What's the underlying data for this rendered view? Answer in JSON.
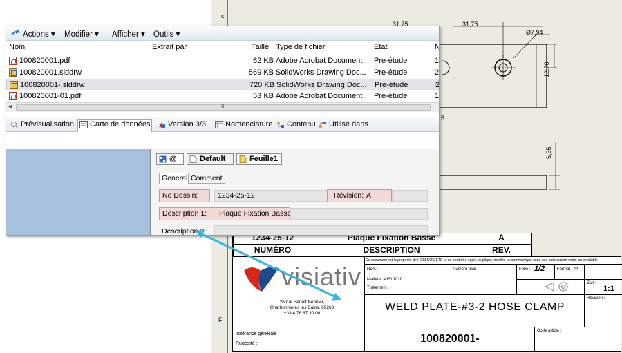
{
  "drawing": {
    "margin_top": "c",
    "margin_bottom": "F",
    "dims": {
      "d1": "31,75",
      "d2": "31,75",
      "diameter": "Ø7,94",
      "height1": "12,70",
      "height2": "6,35",
      "partial": "5"
    },
    "title_block": {
      "numero_value": "1234-25-12",
      "description_value": "Plaque Fixation Basse",
      "rev_value": "A",
      "numero_label": "NUMÉRO",
      "description_label": "DESCRIPTION",
      "rev_label": "REV.",
      "copyright": "Ce document est la propriété de HGM SOCIETE et ne peut être copié, dupliqué, modifié ou communiqué sans une autorisation écrite au préalable",
      "nom_label": "Nom :",
      "numero_plan_label": "Numéro plan :",
      "matiere_label": "Matière : AISI 1020",
      "traitement_label": "Traitement :",
      "folio_label": "Folio :",
      "folio_value": "1/2",
      "format_label": "Format : A4",
      "ech_label": "Ech :",
      "ech_value": "1:1",
      "revision_label": "Révision :",
      "logo_text": "visiativ",
      "address_lines": [
        "26 rue Benoît Bennier,",
        "Charbonnières les Bains, 69260",
        "+33 4 78 87 30 00"
      ],
      "part_title": "WELD PLATE-#3-2 HOSE CLAMP",
      "tolerance_label": "Tolérance générale :",
      "rugosite_label": "Rugosité :",
      "code_article_label": "Code article :",
      "part_number": "100820001-"
    }
  },
  "explorer": {
    "toolbar": {
      "actions": "Actions ▾",
      "modifier": "Modifier ▾",
      "afficher": "Afficher ▾",
      "outils": "Outils ▾"
    },
    "columns": [
      "Nom",
      "Extrait par",
      "Taille",
      "Type de fichier",
      "Etat",
      "N"
    ],
    "files": [
      {
        "name": "100820001.pdf",
        "size": "62 KB",
        "type": "Adobe Acrobat Document",
        "state": "Pre-étude",
        "n": "1"
      },
      {
        "name": "100820001.slddrw",
        "size": "569 KB",
        "type": "SolidWorks Drawing Doc...",
        "state": "Pre-étude",
        "n": "2"
      },
      {
        "name": "100820001-.slddrw",
        "size": "720 KB",
        "type": "SolidWorks Drawing Doc...",
        "state": "Pre-étude",
        "n": "2"
      },
      {
        "name": "100820001-01.pdf",
        "size": "53 KB",
        "type": "Adobe Acrobat Document",
        "state": "Pre-étude",
        "n": "1"
      }
    ],
    "scroll_grip": "III",
    "tabs": [
      "Prévisualisation",
      "Carte de données",
      "Version 3/3",
      "Nomenclature",
      "Contenu",
      "Utilisé dans"
    ],
    "form": {
      "at_tab": "@",
      "default_tab": "Default",
      "feuille_tab": "Feuille1",
      "subtabs": [
        "General",
        "Comment"
      ],
      "no_dessin_label": "No Dessin:",
      "no_dessin_value": "1234-25-12",
      "revision_label": "Révision:",
      "revision_value": "A",
      "description1_label": "Description 1:",
      "description1_value": "Plaque Fixation Basse",
      "description2_label": "Description 2:",
      "description2_value": ""
    }
  },
  "colors": {
    "arrow": "#3fb0d9",
    "highlight": "#e28c8c",
    "data_pane": "#a7c0dd"
  }
}
